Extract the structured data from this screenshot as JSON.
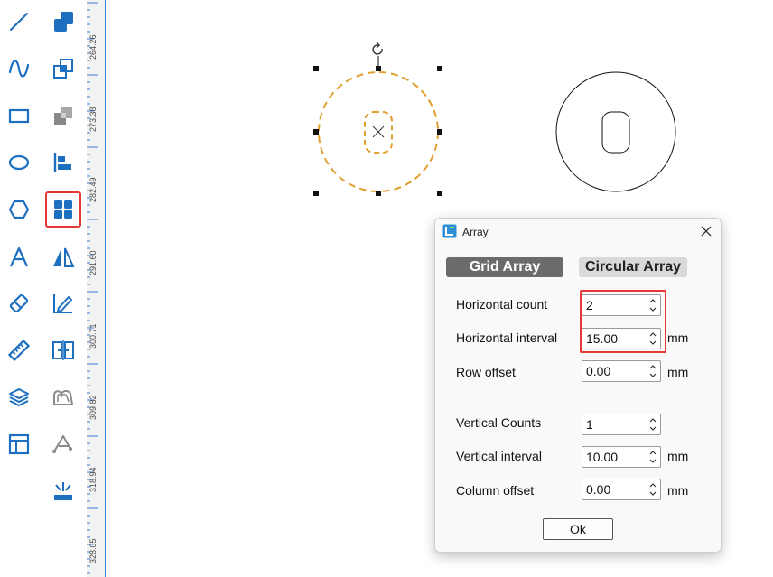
{
  "toolbar": {
    "left_tools": [
      "line-icon",
      "curve-icon",
      "rectangle-icon",
      "ellipse-icon",
      "hexagon-icon",
      "text-icon",
      "eraser-icon",
      "ruler-icon",
      "layers-icon",
      "layout-icon"
    ],
    "right_tools": [
      "combine-icon",
      "duplicate-icon",
      "subtract-icon",
      "align-left-icon",
      "array-icon",
      "mirror-icon",
      "edit-node-icon",
      "distribute-icon",
      "offset-icon",
      "path-icon",
      "laser-icon"
    ],
    "selected_tool": "array-icon",
    "accent_color": "#1d6fbf",
    "highlight_color": "#e53935"
  },
  "ruler": {
    "labels": [
      "264.26",
      "273.38",
      "282.49",
      "291.60",
      "300.71",
      "309.82",
      "318.94",
      "328.05"
    ]
  },
  "dialog": {
    "title": "Array",
    "tabs": {
      "grid": "Grid Array",
      "circular": "Circular Array"
    },
    "active_tab": "grid",
    "fields": {
      "horizontal_count": {
        "label": "Horizontal count",
        "value": "2",
        "unit": ""
      },
      "horizontal_interval": {
        "label": "Horizontal interval",
        "value": "15.00",
        "unit": "mm"
      },
      "row_offset": {
        "label": "Row offset",
        "value": "0.00",
        "unit": "mm"
      },
      "vertical_counts": {
        "label": "Vertical Counts",
        "value": "1",
        "unit": ""
      },
      "vertical_interval": {
        "label": "Vertical interval",
        "value": "10.00",
        "unit": "mm"
      },
      "column_offset": {
        "label": "Column offset",
        "value": "0.00",
        "unit": "mm"
      }
    },
    "ok_label": "Ok"
  }
}
